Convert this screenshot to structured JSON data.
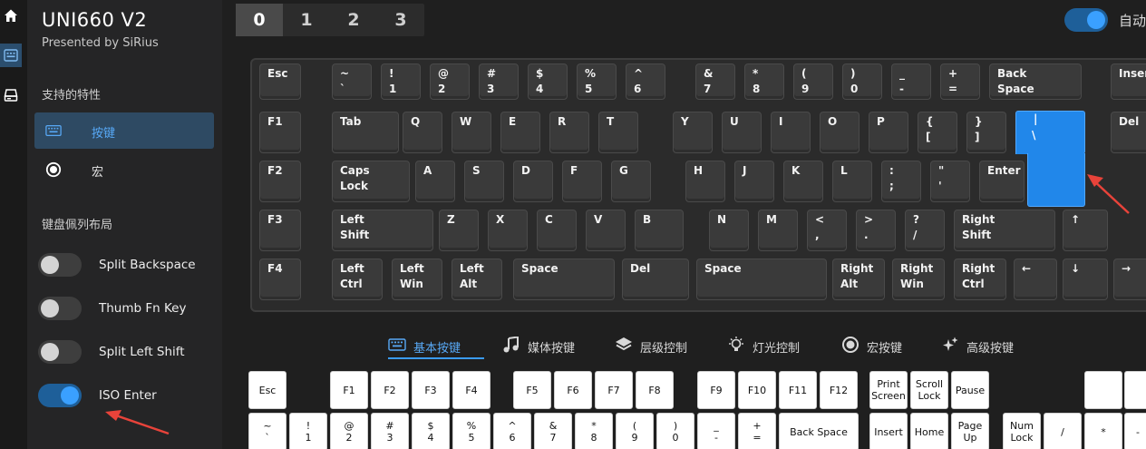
{
  "app": {
    "title": "UNI660 V2",
    "subtitle": "Presented by SiRius"
  },
  "rail": {
    "items": [
      {
        "icon": "home-icon"
      },
      {
        "icon": "keyboard-icon",
        "active": true
      },
      {
        "icon": "printer-icon"
      }
    ]
  },
  "sidebar": {
    "features_heading": "支持的特性",
    "features": [
      {
        "label": "按键",
        "icon": "keyboard-icon",
        "selected": true
      },
      {
        "label": "宏",
        "icon": "radio-icon",
        "selected": false
      }
    ],
    "layout_heading": "键盘佩列布局",
    "toggles": [
      {
        "label": "Split Backspace",
        "on": false
      },
      {
        "label": "Thumb Fn Key",
        "on": false
      },
      {
        "label": "Split Left Shift",
        "on": false
      },
      {
        "label": "ISO Enter",
        "on": true
      }
    ]
  },
  "layers": {
    "tabs": [
      "0",
      "1",
      "2",
      "3"
    ],
    "active": "0"
  },
  "auto_toggle": {
    "label": "自动",
    "on": true
  },
  "keyboard": {
    "keys": [
      {
        "l1": "Esc",
        "l2": ""
      },
      {
        "l1": "~",
        "l2": "`"
      },
      {
        "l1": "!",
        "l2": "1"
      },
      {
        "l1": "@",
        "l2": "2"
      },
      {
        "l1": "#",
        "l2": "3"
      },
      {
        "l1": "$",
        "l2": "4"
      },
      {
        "l1": "%",
        "l2": "5"
      },
      {
        "l1": "^",
        "l2": "6"
      },
      {
        "l1": "&",
        "l2": "7"
      },
      {
        "l1": "*",
        "l2": "8"
      },
      {
        "l1": "(",
        "l2": "9"
      },
      {
        "l1": ")",
        "l2": "0"
      },
      {
        "l1": "_",
        "l2": "-"
      },
      {
        "l1": "+",
        "l2": "="
      },
      {
        "l1": "Back",
        "l2": "Space"
      },
      {
        "l1": "Insert",
        "l2": ""
      },
      {
        "l1": "F1",
        "l2": ""
      },
      {
        "l1": "Tab",
        "l2": ""
      },
      {
        "l1": "Q",
        "l2": ""
      },
      {
        "l1": "W",
        "l2": ""
      },
      {
        "l1": "E",
        "l2": ""
      },
      {
        "l1": "R",
        "l2": ""
      },
      {
        "l1": "T",
        "l2": ""
      },
      {
        "l1": "Y",
        "l2": ""
      },
      {
        "l1": "U",
        "l2": ""
      },
      {
        "l1": "I",
        "l2": ""
      },
      {
        "l1": "O",
        "l2": ""
      },
      {
        "l1": "P",
        "l2": ""
      },
      {
        "l1": "{",
        "l2": "["
      },
      {
        "l1": "}",
        "l2": "]"
      },
      {
        "l1": "Del",
        "l2": ""
      },
      {
        "l1": "F2",
        "l2": ""
      },
      {
        "l1": "Caps",
        "l2": "Lock"
      },
      {
        "l1": "A",
        "l2": ""
      },
      {
        "l1": "S",
        "l2": ""
      },
      {
        "l1": "D",
        "l2": ""
      },
      {
        "l1": "F",
        "l2": ""
      },
      {
        "l1": "G",
        "l2": ""
      },
      {
        "l1": "H",
        "l2": ""
      },
      {
        "l1": "J",
        "l2": ""
      },
      {
        "l1": "K",
        "l2": ""
      },
      {
        "l1": "L",
        "l2": ""
      },
      {
        "l1": ":",
        "l2": ";"
      },
      {
        "l1": "\"",
        "l2": "'"
      },
      {
        "l1": "Enter",
        "l2": ""
      },
      {
        "l1": "F3",
        "l2": ""
      },
      {
        "l1": "Left",
        "l2": "Shift"
      },
      {
        "l1": "Z",
        "l2": ""
      },
      {
        "l1": "X",
        "l2": ""
      },
      {
        "l1": "C",
        "l2": ""
      },
      {
        "l1": "V",
        "l2": ""
      },
      {
        "l1": "B",
        "l2": ""
      },
      {
        "l1": "N",
        "l2": ""
      },
      {
        "l1": "M",
        "l2": ""
      },
      {
        "l1": "<",
        "l2": ","
      },
      {
        "l1": ">",
        "l2": "."
      },
      {
        "l1": "?",
        "l2": "/"
      },
      {
        "l1": "Right",
        "l2": "Shift"
      },
      {
        "l1": "↑",
        "l2": ""
      },
      {
        "l1": "F4",
        "l2": ""
      },
      {
        "l1": "Left",
        "l2": "Ctrl"
      },
      {
        "l1": "Left",
        "l2": "Win"
      },
      {
        "l1": "Left",
        "l2": "Alt"
      },
      {
        "l1": "Space",
        "l2": ""
      },
      {
        "l1": "Del",
        "l2": ""
      },
      {
        "l1": "Space",
        "l2": ""
      },
      {
        "l1": "Right",
        "l2": "Alt"
      },
      {
        "l1": "Right",
        "l2": "Win"
      },
      {
        "l1": "Right",
        "l2": "Ctrl"
      },
      {
        "l1": "←",
        "l2": ""
      },
      {
        "l1": "↓",
        "l2": ""
      },
      {
        "l1": "→",
        "l2": ""
      }
    ],
    "iso_enter": {
      "l1": "|",
      "l2": "\\"
    }
  },
  "categories": [
    {
      "label": "基本按键",
      "icon": "keyboard-icon",
      "active": true
    },
    {
      "label": "媒体按键",
      "icon": "music-note-icon",
      "active": false
    },
    {
      "label": "层级控制",
      "icon": "layers-icon",
      "active": false
    },
    {
      "label": "灯光控制",
      "icon": "lightbulb-icon",
      "active": false
    },
    {
      "label": "宏按键",
      "icon": "record-icon",
      "active": false
    },
    {
      "label": "高级按键",
      "icon": "sparkle-icon",
      "active": false
    }
  ],
  "selector": {
    "keys": [
      {
        "l1": "Esc",
        "l2": ""
      },
      {
        "l1": "F1",
        "l2": ""
      },
      {
        "l1": "F2",
        "l2": ""
      },
      {
        "l1": "F3",
        "l2": ""
      },
      {
        "l1": "F4",
        "l2": ""
      },
      {
        "l1": "F5",
        "l2": ""
      },
      {
        "l1": "F6",
        "l2": ""
      },
      {
        "l1": "F7",
        "l2": ""
      },
      {
        "l1": "F8",
        "l2": ""
      },
      {
        "l1": "F9",
        "l2": ""
      },
      {
        "l1": "F10",
        "l2": ""
      },
      {
        "l1": "F11",
        "l2": ""
      },
      {
        "l1": "F12",
        "l2": ""
      },
      {
        "l1": "Print",
        "l2": "Screen"
      },
      {
        "l1": "Scroll",
        "l2": "Lock"
      },
      {
        "l1": "Pause",
        "l2": ""
      },
      {
        "l1": "",
        "l2": ""
      },
      {
        "l1": "",
        "l2": ""
      },
      {
        "l1": "~",
        "l2": "`"
      },
      {
        "l1": "!",
        "l2": "1"
      },
      {
        "l1": "@",
        "l2": "2"
      },
      {
        "l1": "#",
        "l2": "3"
      },
      {
        "l1": "$",
        "l2": "4"
      },
      {
        "l1": "%",
        "l2": "5"
      },
      {
        "l1": "^",
        "l2": "6"
      },
      {
        "l1": "&",
        "l2": "7"
      },
      {
        "l1": "*",
        "l2": "8"
      },
      {
        "l1": "(",
        "l2": "9"
      },
      {
        "l1": ")",
        "l2": "0"
      },
      {
        "l1": "_",
        "l2": "-"
      },
      {
        "l1": "+",
        "l2": "="
      },
      {
        "l1": "Back Space",
        "l2": ""
      },
      {
        "l1": "Insert",
        "l2": ""
      },
      {
        "l1": "Home",
        "l2": ""
      },
      {
        "l1": "Page",
        "l2": "Up"
      },
      {
        "l1": "Num",
        "l2": "Lock"
      },
      {
        "l1": "/",
        "l2": ""
      },
      {
        "l1": "*",
        "l2": ""
      },
      {
        "l1": "-",
        "l2": ""
      }
    ]
  },
  "colors": {
    "accent": "#3a9bf5",
    "selected_key": "#2187ea",
    "annotation_arrow": "#e8433a"
  }
}
